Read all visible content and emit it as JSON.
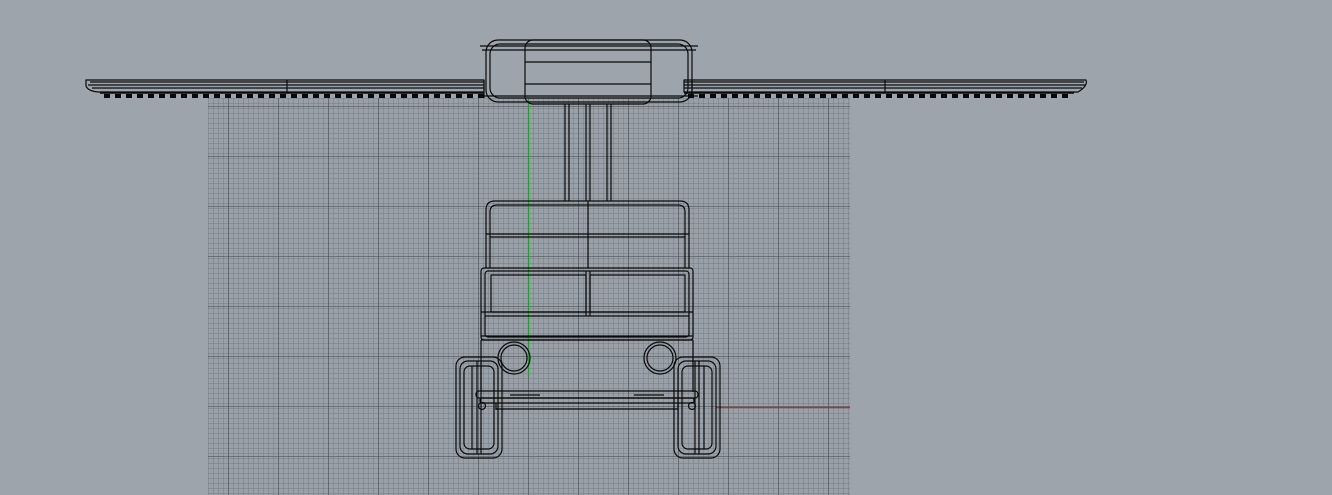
{
  "viewport": {
    "view": "front",
    "display_mode": "wireframe",
    "grid_visible": true,
    "axes_visible": true
  },
  "colors": {
    "background": "#9ea4ab",
    "grid_major": "#4e545c",
    "grid_minor": "#6a7078",
    "wireframe": "#0a0a0a",
    "x_axis": "#c0282a",
    "y_axis": "#1e9e2e"
  }
}
